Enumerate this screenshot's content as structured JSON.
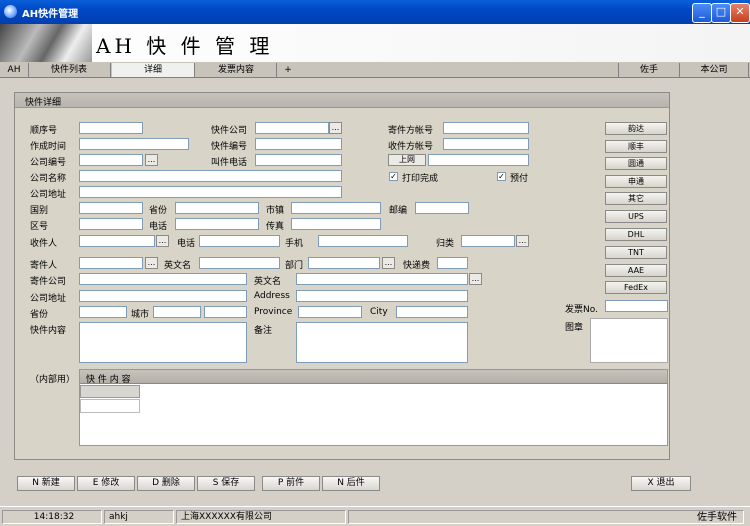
{
  "window": {
    "title": "AH快件管理"
  },
  "banner": {
    "title": "AH 快 件 管 理"
  },
  "tabs": {
    "ah": "AH",
    "list": "快件列表",
    "detail": "详细",
    "invoice": "发票内容",
    "add": "+",
    "right1": "佐手",
    "right2": "本公司"
  },
  "panel": {
    "title": "快件详细"
  },
  "form": {
    "seq": "顺序号",
    "created": "作成时间",
    "company_no": "公司编号",
    "company_name": "公司名称",
    "company_addr": "公司地址",
    "courier": "快件公司",
    "waybill": "快件编号",
    "call_phone": "叫件电话",
    "sender_acct": "寄件方帐号",
    "receiver_acct": "收件方帐号",
    "online_btn": "上网",
    "print_done": "打印完成",
    "prepaid": "预付",
    "country": "国别",
    "province": "省份",
    "city_town": "市镇",
    "postcode": "邮编",
    "district": "区号",
    "phone": "电话",
    "fax": "传真",
    "recipient": "收件人",
    "phone2": "电话",
    "mobile": "手机",
    "category": "归类",
    "sender": "寄件人",
    "english_name": "英文名",
    "dept": "部门",
    "fee": "快递费",
    "sender_company": "寄件公司",
    "english_name2": "英文名",
    "company_addr2": "公司地址",
    "address_en": "Address",
    "province2": "省份",
    "city2": "城市",
    "province_en": "Province",
    "city_en": "City",
    "content": "快件内容",
    "remark": "备注",
    "invoice_no": "发票No.",
    "seal": "图章",
    "internal": "（内部用）",
    "grid_header": "快 件 内 容"
  },
  "side_buttons": [
    "韵达",
    "顺丰",
    "圆通",
    "申通",
    "其它",
    "UPS",
    "DHL",
    "TNT",
    "AAE",
    "FedEx"
  ],
  "bottom": {
    "new": "N 新建",
    "edit": "E 修改",
    "delete": "D 删除",
    "save": "S 保存",
    "prev": "P 前件",
    "next": "N 后件",
    "exit": "X 退出"
  },
  "status": {
    "time": "14:18:32",
    "user": "ahkj",
    "company": "上海XXXXXX有限公司",
    "brand": "佐手软件"
  },
  "colors": {
    "titlebar": "#0048c8",
    "panel": "#d8d4c8"
  }
}
